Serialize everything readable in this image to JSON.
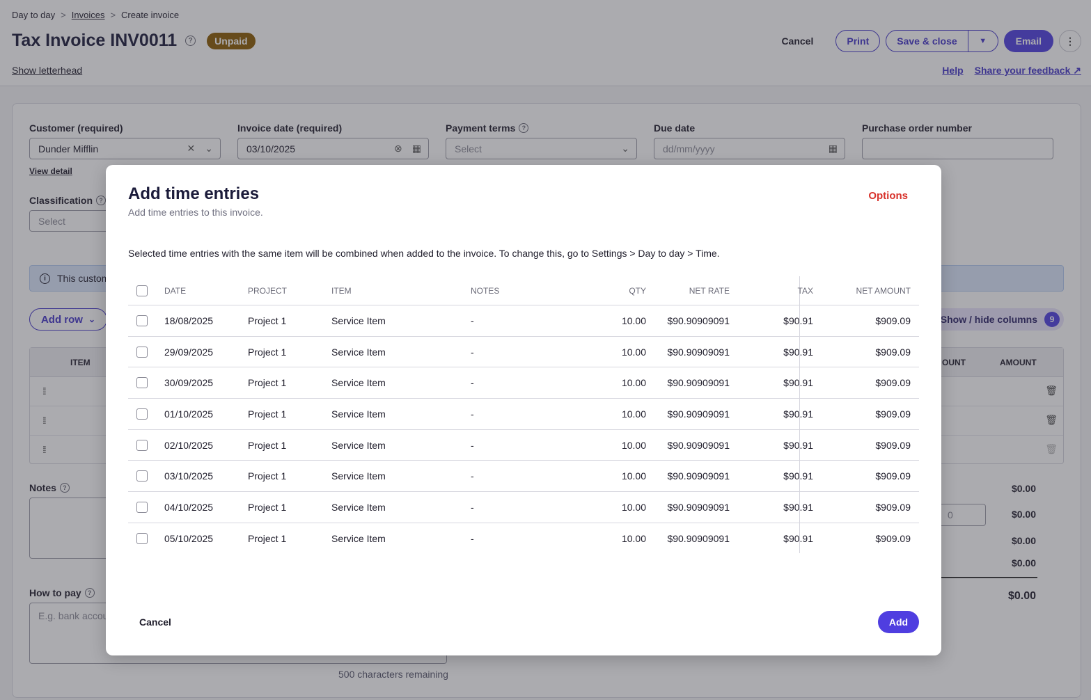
{
  "breadcrumb": {
    "items": [
      "Day to day",
      "Invoices",
      "Create invoice"
    ],
    "sep": ">"
  },
  "header": {
    "title": "Tax Invoice INV0011",
    "status": "Unpaid",
    "show_letterhead": "Show letterhead",
    "actions": {
      "cancel": "Cancel",
      "print": "Print",
      "save_close": "Save & close",
      "email": "Email",
      "more": "⋮"
    },
    "links": {
      "help": "Help",
      "feedback": "Share your feedback"
    }
  },
  "form": {
    "customer": {
      "label": "Customer (required)",
      "value": "Dunder Mifflin",
      "view_detail": "View detail"
    },
    "invoice_date": {
      "label": "Invoice date (required)",
      "value": "03/10/2025"
    },
    "payment_terms": {
      "label": "Payment terms",
      "placeholder": "Select"
    },
    "due_date": {
      "label": "Due date",
      "placeholder": "dd/mm/yyyy"
    },
    "po_number": {
      "label": "Purchase order number",
      "value": ""
    },
    "classification": {
      "label": "Classification",
      "placeholder": "Select"
    },
    "banner_text": "This custom",
    "add_row": "Add row",
    "show_hide": "Show / hide columns",
    "column_count": "9",
    "line_headers": {
      "item": "ITEM",
      "discount": "OUNT",
      "amount": "AMOUNT"
    },
    "notes": {
      "label": "Notes"
    },
    "how_to_pay": {
      "label": "How to pay",
      "placeholder": "E.g. bank accou"
    },
    "chars_remaining": "500 characters remaining",
    "discount_placeholder": "0",
    "totals": [
      "$0.00",
      "$0.00",
      "$0.00",
      "$0.00",
      "$0.00"
    ]
  },
  "modal": {
    "title": "Add time entries",
    "subtitle": "Add time entries to this invoice.",
    "options": "Options",
    "note": "Selected time entries with the same item will be combined when added to the invoice. To change this, go to Settings > Day to day > Time.",
    "columns": {
      "date": "DATE",
      "project": "PROJECT",
      "item": "ITEM",
      "notes": "NOTES",
      "qty": "QTY",
      "net_rate": "NET RATE",
      "tax": "TAX",
      "net_amount": "NET AMOUNT"
    },
    "rows": [
      {
        "date": "18/08/2025",
        "project": "Project 1",
        "item": "Service Item",
        "notes": "-",
        "qty": "10.00",
        "net_rate": "$90.90909091",
        "tax": "$90.91",
        "net_amount": "$909.09"
      },
      {
        "date": "29/09/2025",
        "project": "Project 1",
        "item": "Service Item",
        "notes": "-",
        "qty": "10.00",
        "net_rate": "$90.90909091",
        "tax": "$90.91",
        "net_amount": "$909.09"
      },
      {
        "date": "30/09/2025",
        "project": "Project 1",
        "item": "Service Item",
        "notes": "-",
        "qty": "10.00",
        "net_rate": "$90.90909091",
        "tax": "$90.91",
        "net_amount": "$909.09"
      },
      {
        "date": "01/10/2025",
        "project": "Project 1",
        "item": "Service Item",
        "notes": "-",
        "qty": "10.00",
        "net_rate": "$90.90909091",
        "tax": "$90.91",
        "net_amount": "$909.09"
      },
      {
        "date": "02/10/2025",
        "project": "Project 1",
        "item": "Service Item",
        "notes": "-",
        "qty": "10.00",
        "net_rate": "$90.90909091",
        "tax": "$90.91",
        "net_amount": "$909.09"
      },
      {
        "date": "03/10/2025",
        "project": "Project 1",
        "item": "Service Item",
        "notes": "-",
        "qty": "10.00",
        "net_rate": "$90.90909091",
        "tax": "$90.91",
        "net_amount": "$909.09"
      },
      {
        "date": "04/10/2025",
        "project": "Project 1",
        "item": "Service Item",
        "notes": "-",
        "qty": "10.00",
        "net_rate": "$90.90909091",
        "tax": "$90.91",
        "net_amount": "$909.09"
      },
      {
        "date": "05/10/2025",
        "project": "Project 1",
        "item": "Service Item",
        "notes": "-",
        "qty": "10.00",
        "net_rate": "$90.90909091",
        "tax": "$90.91",
        "net_amount": "$909.09"
      }
    ],
    "cancel": "Cancel",
    "add": "Add"
  },
  "colors": {
    "primary": "#4f3ee0",
    "outline": "#4436c9",
    "danger": "#d8322b",
    "unpaid_badge": "#8a5a00",
    "banner": "#dbe7fb"
  }
}
